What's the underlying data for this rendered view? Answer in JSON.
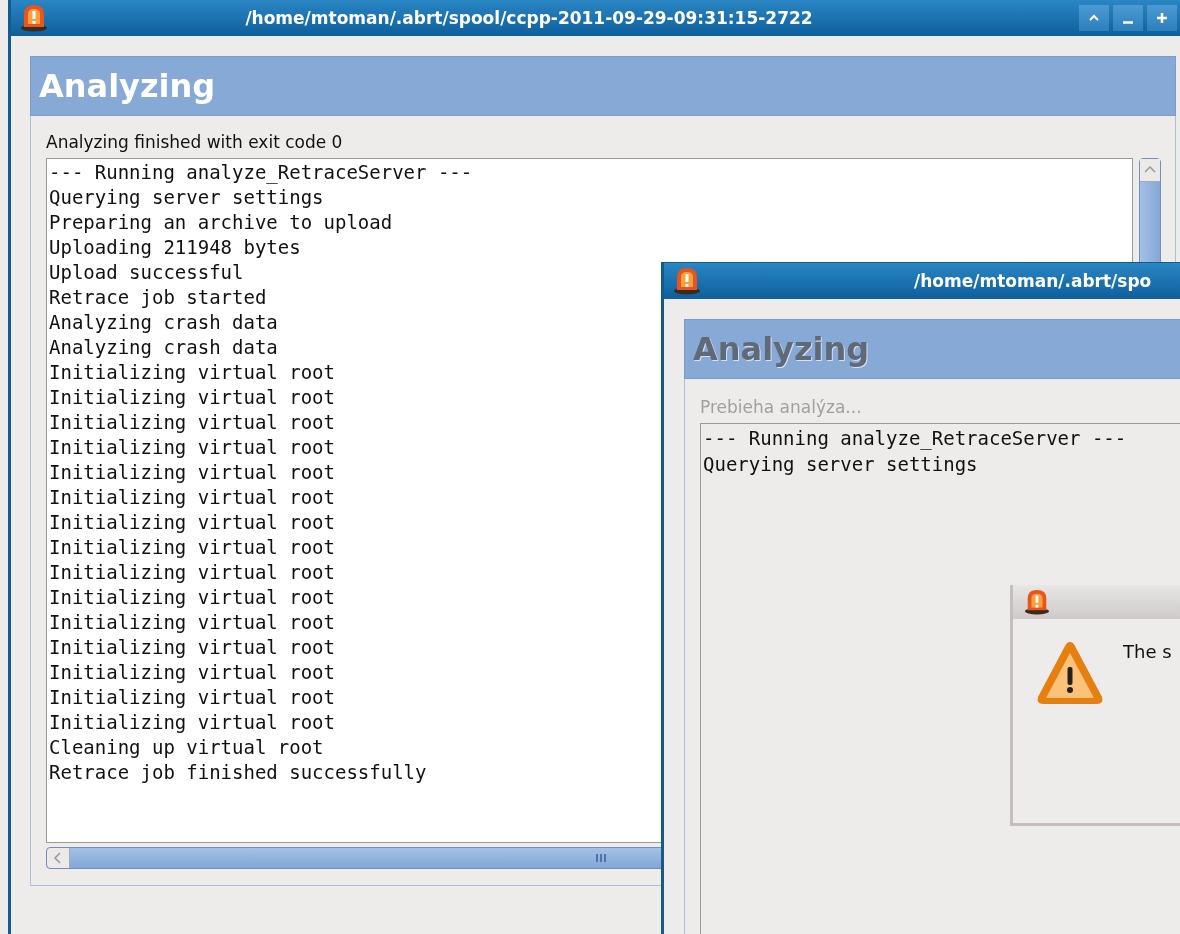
{
  "windows": [
    {
      "kind": "main",
      "title": "/home/mtoman/.abrt/spool/ccpp-2011-09-29-09:31:15-2722",
      "heading": "Analyzing",
      "disabled": false,
      "status": "Analyzing finished with exit code 0",
      "log": [
        "--- Running analyze_RetraceServer ---",
        "Querying server settings",
        "Preparing an archive to upload",
        "Uploading 211948 bytes",
        "Upload successful",
        "Retrace job started",
        "Analyzing crash data",
        "Analyzing crash data",
        "Initializing virtual root",
        "Initializing virtual root",
        "Initializing virtual root",
        "Initializing virtual root",
        "Initializing virtual root",
        "Initializing virtual root",
        "Initializing virtual root",
        "Initializing virtual root",
        "Initializing virtual root",
        "Initializing virtual root",
        "Initializing virtual root",
        "Initializing virtual root",
        "Initializing virtual root",
        "Initializing virtual root",
        "Initializing virtual root",
        "Cleaning up virtual root",
        "Retrace job finished successfully"
      ]
    },
    {
      "kind": "child",
      "title": "/home/mtoman/.abrt/spo",
      "heading": "Analyzing",
      "disabled": true,
      "status": "Prebieha analýza...",
      "log": [
        "--- Running analyze_RetraceServer ---",
        "Querying server settings"
      ]
    }
  ],
  "dialog": {
    "message": "The s"
  }
}
